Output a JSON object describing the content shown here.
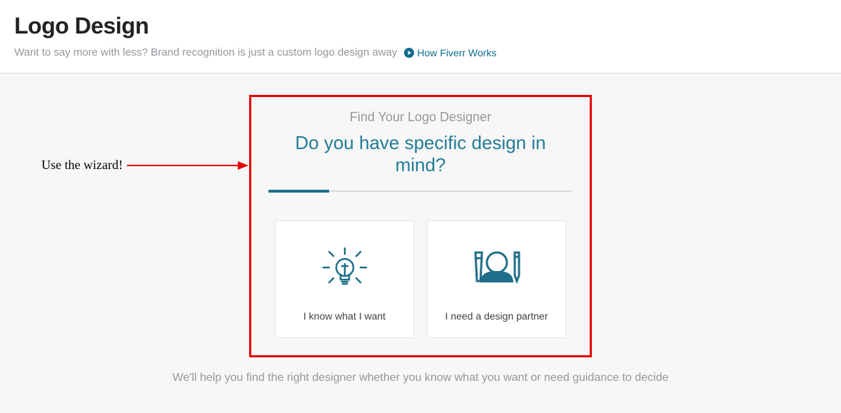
{
  "header": {
    "title": "Logo Design",
    "subtext": "Want to say more with less? Brand recognition is just a custom logo design away",
    "how_link": "How Fiverr Works"
  },
  "annotation": {
    "label": "Use the wizard!"
  },
  "wizard": {
    "subtitle": "Find Your Logo Designer",
    "question": "Do you have specific design in mind?",
    "option_know": "I know what I want",
    "option_partner": "I need a design partner"
  },
  "helper": {
    "text": "We'll help you find the right designer whether you know what you want or need guidance to decide"
  }
}
